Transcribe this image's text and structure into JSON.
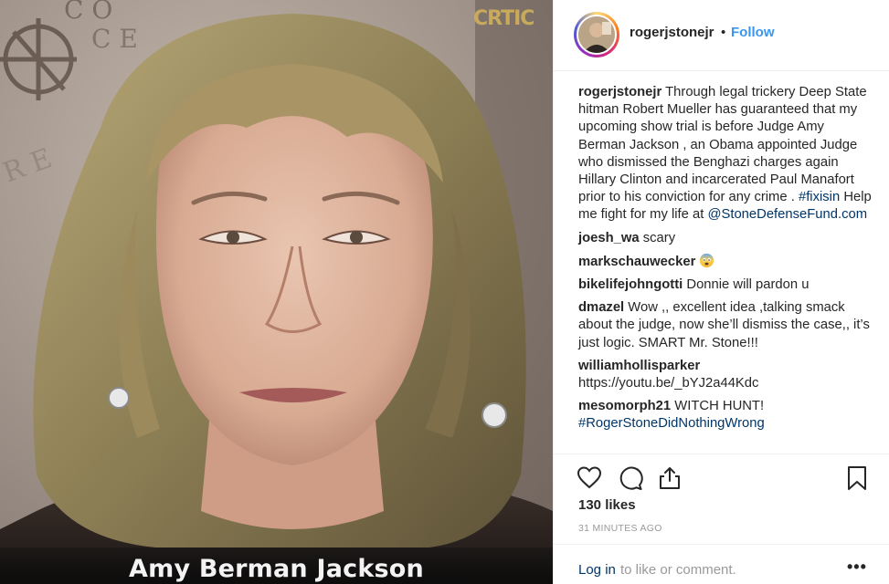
{
  "media": {
    "caption": "Amy Berman Jackson",
    "watermark": "CRTIC"
  },
  "post": {
    "username": "rogerjstonejr",
    "separator": "•",
    "follow_label": "Follow",
    "caption": {
      "username": "rogerjstonejr",
      "text": "Through legal trickery Deep State hitman Robert Mueller has guaranteed that my upcoming show trial is before Judge Amy Berman Jackson , an Obama appointed Judge who dismissed the Benghazi charges again Hillary Clinton and incarcerated Paul Manafort prior to his conviction for any crime .",
      "hashtag": "#fixisin",
      "text2": "Help me fight for my life at",
      "mention": "@StoneDefenseFund.com"
    },
    "comments": [
      {
        "username": "joesh_wa",
        "text": "scary"
      },
      {
        "username": "markschauwecker",
        "text": "",
        "emoji": "fearful-face-emoji"
      },
      {
        "username": "bikelifejohngotti",
        "text": "Donnie will pardon u"
      },
      {
        "username": "dmazel",
        "text": "Wow ,, excellent idea ,talking smack about the judge, now she’ll dismiss the case,, it’s just logic. SMART Mr. Stone!!!"
      },
      {
        "username": "williamhollisparker",
        "text": "https://youtu.be/_bYJ2a44Kdc"
      },
      {
        "username": "mesomorph21",
        "text": "WITCH HUNT!",
        "hashtag": "#RogerStoneDidNothingWrong"
      }
    ],
    "likes": "130 likes",
    "timestamp": "31 MINUTES AGO",
    "login_link": "Log in",
    "login_rest": "to like or comment.",
    "more": "•••"
  },
  "icons": {
    "like": "heart-icon",
    "comment": "comment-icon",
    "share": "share-icon",
    "save": "bookmark-icon"
  },
  "colors": {
    "link_blue": "#3897f0",
    "dark_link": "#003569",
    "muted": "#999999",
    "text": "#262626"
  }
}
